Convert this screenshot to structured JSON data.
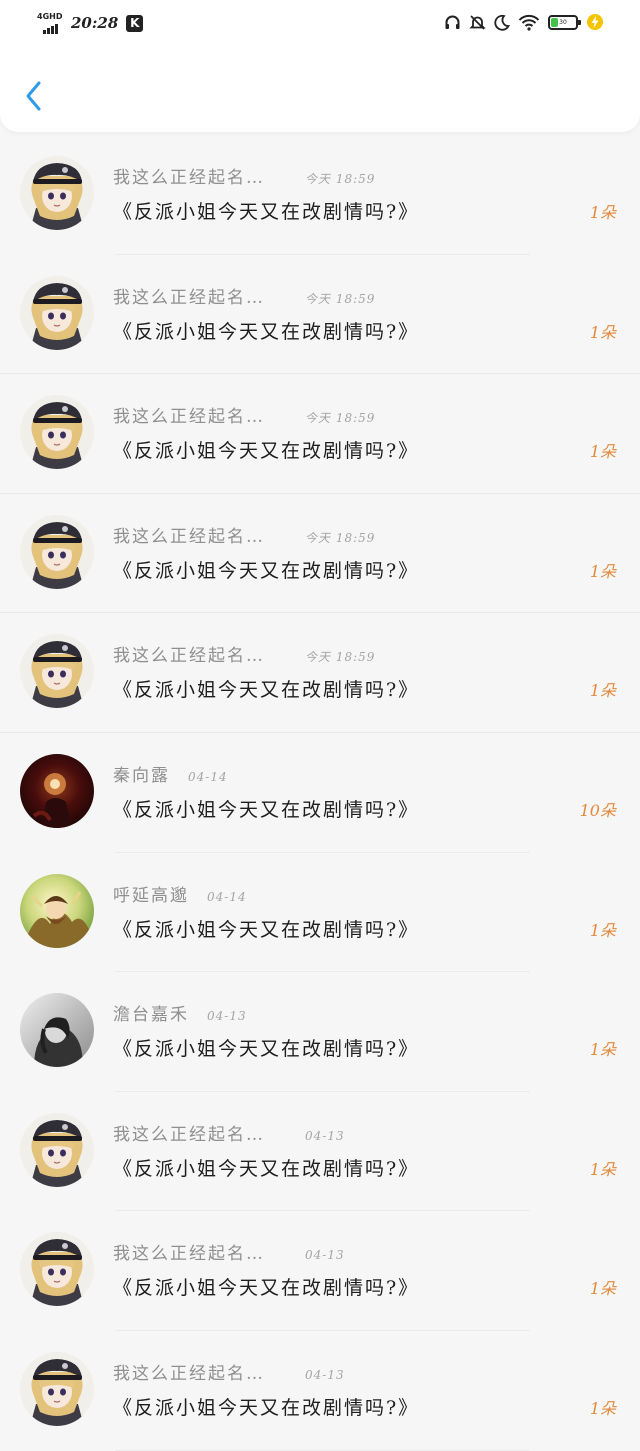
{
  "status_bar": {
    "network": "4GHD",
    "time": "20:28",
    "app_badge": "K",
    "battery_level": 30,
    "battery_label": "30",
    "battery_color": "#42c14a",
    "icons": [
      "headphones-icon",
      "bell-off-icon",
      "moon-icon",
      "wifi-icon",
      "charging-icon"
    ]
  },
  "header": {
    "back_icon": "chevron-left-icon",
    "accent_color": "#2c9be8"
  },
  "colors": {
    "count": "#e28a3c",
    "name": "#8f8f8f",
    "title": "#1e1e1e"
  },
  "rows": [
    {
      "name": "我这么正经起名…",
      "time": "今天 18:59",
      "title": "《反派小姐今天又在改剧情吗?》",
      "count": "1朵",
      "avatar": "avatar-anime-cap"
    },
    {
      "name": "我这么正经起名…",
      "time": "今天 18:59",
      "title": "《反派小姐今天又在改剧情吗?》",
      "count": "1朵",
      "avatar": "avatar-anime-cap"
    },
    {
      "name": "我这么正经起名…",
      "time": "今天 18:59",
      "title": "《反派小姐今天又在改剧情吗?》",
      "count": "1朵",
      "avatar": "avatar-anime-cap"
    },
    {
      "name": "我这么正经起名…",
      "time": "今天 18:59",
      "title": "《反派小姐今天又在改剧情吗?》",
      "count": "1朵",
      "avatar": "avatar-anime-cap"
    },
    {
      "name": "我这么正经起名…",
      "time": "今天 18:59",
      "title": "《反派小姐今天又在改剧情吗?》",
      "count": "1朵",
      "avatar": "avatar-anime-cap"
    },
    {
      "name": "秦向露",
      "time": "04-14",
      "title": "《反派小姐今天又在改剧情吗?》",
      "count": "10朵",
      "avatar": "avatar-dark-red"
    },
    {
      "name": "呼延高邈",
      "time": "04-14",
      "title": "《反派小姐今天又在改剧情吗?》",
      "count": "1朵",
      "avatar": "avatar-green-gold"
    },
    {
      "name": "澹台嘉禾",
      "time": "04-13",
      "title": "《反派小姐今天又在改剧情吗?》",
      "count": "1朵",
      "avatar": "avatar-grayscale"
    },
    {
      "name": "我这么正经起名…",
      "time": "04-13",
      "title": "《反派小姐今天又在改剧情吗?》",
      "count": "1朵",
      "avatar": "avatar-anime-cap"
    },
    {
      "name": "我这么正经起名…",
      "time": "04-13",
      "title": "《反派小姐今天又在改剧情吗?》",
      "count": "1朵",
      "avatar": "avatar-anime-cap"
    },
    {
      "name": "我这么正经起名…",
      "time": "04-13",
      "title": "《反派小姐今天又在改剧情吗?》",
      "count": "1朵",
      "avatar": "avatar-anime-cap"
    }
  ]
}
